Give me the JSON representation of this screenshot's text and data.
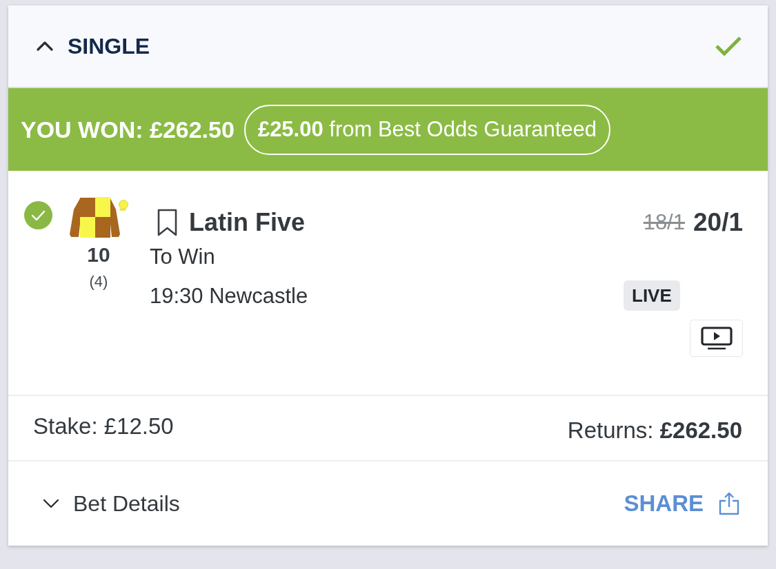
{
  "header": {
    "title": "SINGLE",
    "expanded": true,
    "settled": true
  },
  "banner": {
    "result": "YOU WON: £262.50",
    "bonus": "**£25.00** from Best Odds Guaranteed"
  },
  "selection": {
    "won": true,
    "runner_number": "10",
    "stall": "(4)",
    "bookmarked": false,
    "name": "Latin Five",
    "market": "To Win",
    "event": "19:30 Newcastle",
    "previous_odds": "18/1",
    "odds": "20/1",
    "badge": "LIVE"
  },
  "totals": {
    "stake": "Stake: £12.50",
    "returns": "Returns: **£262.50**"
  },
  "footer": {
    "details_label": "Bet Details",
    "details_expanded": false,
    "share_label": "SHARE"
  }
}
